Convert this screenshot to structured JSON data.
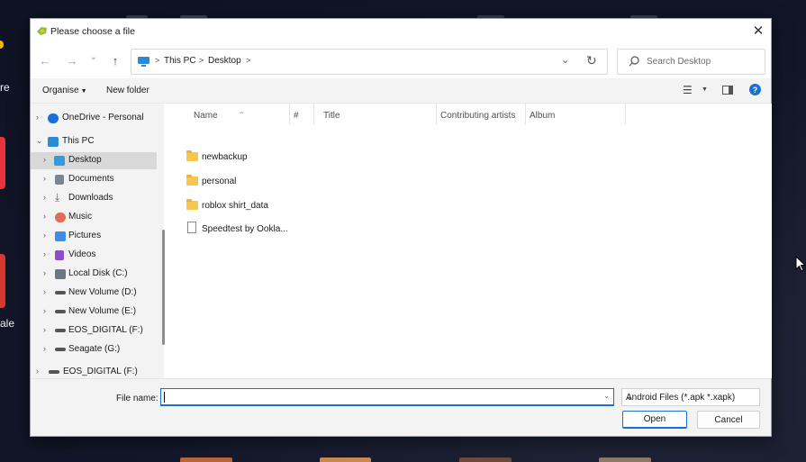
{
  "background_app": {
    "edge_text_1": "re",
    "edge_text_2": "ale"
  },
  "dialog": {
    "title": "Please choose a file",
    "close_symbol": "✕"
  },
  "nav": {
    "back_symbol": "←",
    "forward_symbol": "→",
    "recent_symbol": "⌄",
    "up_symbol": "↑",
    "breadcrumbs": [
      "This PC",
      "Desktop"
    ],
    "separator": ">",
    "dropdown_symbol": "⌄",
    "refresh_symbol": "↻"
  },
  "search": {
    "placeholder": "Search Desktop"
  },
  "toolbar": {
    "organise_label": "Organise",
    "new_folder_label": "New folder",
    "view_symbol": "☰",
    "help_symbol": "?"
  },
  "tree": {
    "items": [
      {
        "label": "OneDrive - Personal",
        "icon": "cloud-icon",
        "color": "#1a6fd6"
      },
      {
        "label": "This PC",
        "icon": "computer-icon",
        "color": "#2a8ad4"
      },
      {
        "label": "Desktop",
        "icon": "desktop-icon",
        "color": "#3a9ad9"
      },
      {
        "label": "Documents",
        "icon": "documents-icon",
        "color": "#7a8591"
      },
      {
        "label": "Downloads",
        "icon": "download-icon",
        "color": "#2b8a3e"
      },
      {
        "label": "Music",
        "icon": "music-icon",
        "color": "#e06c5a"
      },
      {
        "label": "Pictures",
        "icon": "pictures-icon",
        "color": "#3a8ee6"
      },
      {
        "label": "Videos",
        "icon": "videos-icon",
        "color": "#8b4fc9"
      },
      {
        "label": "Local Disk (C:)",
        "icon": "disk-icon",
        "color": "#6b7785"
      },
      {
        "label": "New Volume (D:)",
        "icon": "drive-icon",
        "color": "#555555"
      },
      {
        "label": "New Volume (E:)",
        "icon": "drive-icon",
        "color": "#555555"
      },
      {
        "label": "EOS_DIGITAL (F:)",
        "icon": "drive-icon",
        "color": "#555555"
      },
      {
        "label": "Seagate (G:)",
        "icon": "drive-icon",
        "color": "#555555"
      },
      {
        "label": "EOS_DIGITAL (F:)",
        "icon": "drive-icon",
        "color": "#555555"
      }
    ]
  },
  "columns": [
    "Name",
    "#",
    "Title",
    "Contributing artists",
    "Album"
  ],
  "files": [
    {
      "name": "newbackup",
      "type": "folder"
    },
    {
      "name": "personal",
      "type": "folder"
    },
    {
      "name": "roblox shirt_data",
      "type": "folder"
    },
    {
      "name": "Speedtest by Ookla...",
      "type": "file"
    }
  ],
  "bottom": {
    "file_name_label": "File name:",
    "file_name_value": "",
    "file_type": "Android Files (*.apk *.xapk)",
    "open_label": "Open",
    "cancel_label": "Cancel"
  }
}
